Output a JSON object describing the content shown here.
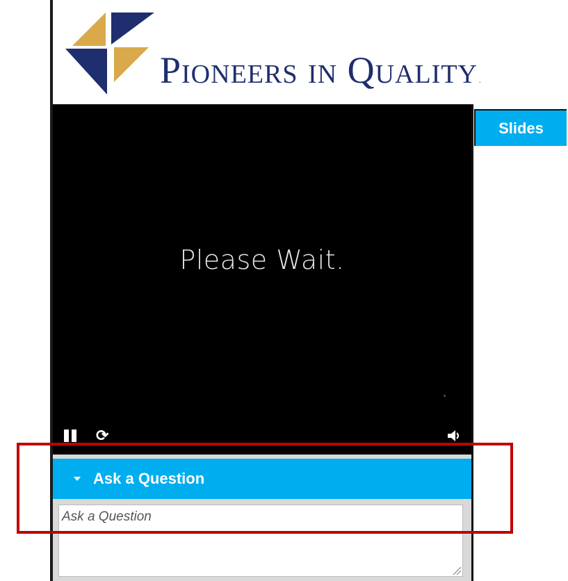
{
  "logo": {
    "text": "Pioneers in Quality",
    "trademark": "."
  },
  "video": {
    "status_text": "Please Wait.",
    "controls": {
      "pause_icon": "pause-icon",
      "refresh_icon": "refresh-icon",
      "volume_icon": "volume-icon"
    }
  },
  "tabs": {
    "slides_label": "Slides"
  },
  "question": {
    "header_label": "Ask a Question",
    "input_placeholder": "Ask a Question",
    "input_value": ""
  },
  "colors": {
    "accent": "#00aeef",
    "logo_navy": "#1e2e6e",
    "logo_gold": "#d9a94a",
    "highlight": "#c00000"
  }
}
